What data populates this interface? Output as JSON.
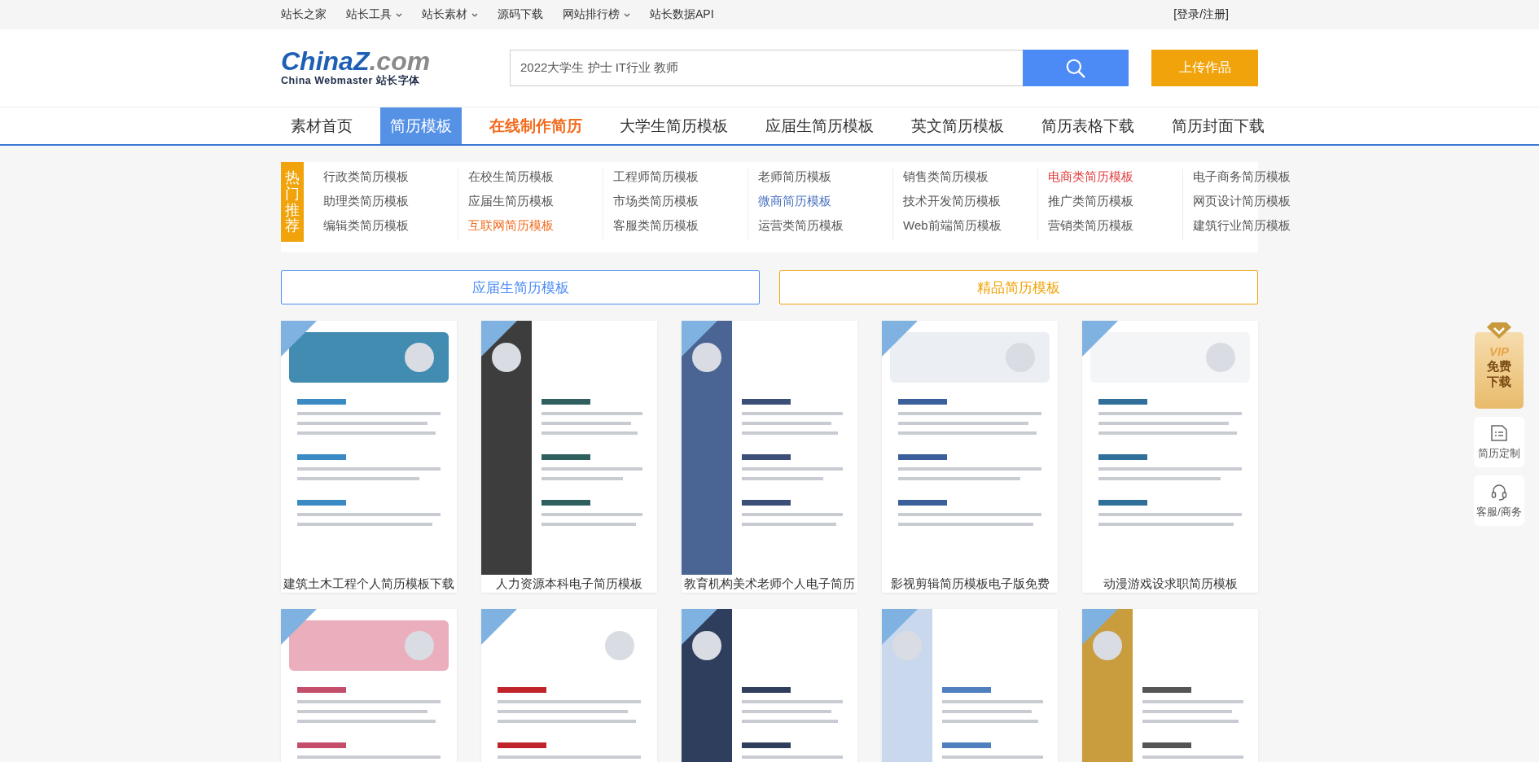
{
  "top_bar": {
    "links": [
      {
        "label": "站长之家",
        "has_menu": false
      },
      {
        "label": "站长工具",
        "has_menu": true
      },
      {
        "label": "站长素材",
        "has_menu": true
      },
      {
        "label": "源码下载",
        "has_menu": false
      },
      {
        "label": "网站排行榜",
        "has_menu": true
      },
      {
        "label": "站长数据API",
        "has_menu": false
      }
    ],
    "login": "[登录/注册]"
  },
  "logo": {
    "brand": "ChinaZ",
    "domain": ".com",
    "tagline": "China Webmaster 站长字体"
  },
  "search": {
    "value": "2022大学生 护士 IT行业 教师"
  },
  "upload_button": "上传作品",
  "nav": [
    {
      "label": "素材首页",
      "selected": false,
      "highlight": false
    },
    {
      "label": "简历模板",
      "selected": true,
      "highlight": false
    },
    {
      "label": "在线制作简历",
      "selected": false,
      "highlight": true
    },
    {
      "label": "大学生简历模板",
      "selected": false,
      "highlight": false
    },
    {
      "label": "应届生简历模板",
      "selected": false,
      "highlight": false
    },
    {
      "label": "英文简历模板",
      "selected": false,
      "highlight": false
    },
    {
      "label": "简历表格下载",
      "selected": false,
      "highlight": false
    },
    {
      "label": "简历封面下载",
      "selected": false,
      "highlight": false
    }
  ],
  "hot": {
    "label": "热门推荐",
    "columns": [
      [
        {
          "label": "行政类简历模板",
          "color": "#555555"
        },
        {
          "label": "助理类简历模板",
          "color": "#555555"
        },
        {
          "label": "编辑类简历模板",
          "color": "#555555"
        }
      ],
      [
        {
          "label": "在校生简历模板",
          "color": "#555555"
        },
        {
          "label": "应届生简历模板",
          "color": "#555555"
        },
        {
          "label": "互联网简历模板",
          "color": "#f26b1d"
        }
      ],
      [
        {
          "label": "工程师简历模板",
          "color": "#555555"
        },
        {
          "label": "市场类简历模板",
          "color": "#555555"
        },
        {
          "label": "客服类简历模板",
          "color": "#555555"
        }
      ],
      [
        {
          "label": "老师简历模板",
          "color": "#555555"
        },
        {
          "label": "微商简历模板",
          "color": "#4a72c2"
        },
        {
          "label": "运营类简历模板",
          "color": "#555555"
        }
      ],
      [
        {
          "label": "销售类简历模板",
          "color": "#555555"
        },
        {
          "label": "技术开发简历模板",
          "color": "#555555"
        },
        {
          "label": "Web前端简历模板",
          "color": "#555555"
        }
      ],
      [
        {
          "label": "电商类简历模板",
          "color": "#e03c3c"
        },
        {
          "label": "推广类简历模板",
          "color": "#555555"
        },
        {
          "label": "营销类简历模板",
          "color": "#555555"
        }
      ],
      [
        {
          "label": "电子商务简历模板",
          "color": "#555555"
        },
        {
          "label": "网页设计简历模板",
          "color": "#555555"
        },
        {
          "label": "建筑行业简历模板",
          "color": "#555555"
        }
      ]
    ]
  },
  "category_buttons": [
    {
      "label": "应届生简历模板",
      "color": "#4c8bf5"
    },
    {
      "label": "精品简历模板",
      "color": "#f0a30a"
    }
  ],
  "cards": [
    {
      "kind": "picture",
      "caption": "建筑土木工程个人简历模板下载"
    },
    {
      "kind": "picture",
      "caption": "人力资源本科电子简历模板"
    },
    {
      "kind": "picture",
      "caption": "教育机构美术老师个人电子简历"
    },
    {
      "kind": "picture",
      "caption": "影视剪辑简历模板电子版免费"
    },
    {
      "kind": "picture",
      "caption": "动漫游戏设求职简历模板"
    },
    {
      "kind": "picture"
    },
    {
      "kind": "picture"
    },
    {
      "kind": "picture"
    },
    {
      "kind": "picture"
    },
    {
      "kind": "picture"
    }
  ],
  "side": {
    "vip": {
      "top": "VIP",
      "line1": "免费",
      "line2": "下载"
    },
    "buttons": [
      {
        "kind": "form",
        "label": "简历定制"
      },
      {
        "kind": "headset",
        "label": "客服/商务"
      }
    ]
  }
}
